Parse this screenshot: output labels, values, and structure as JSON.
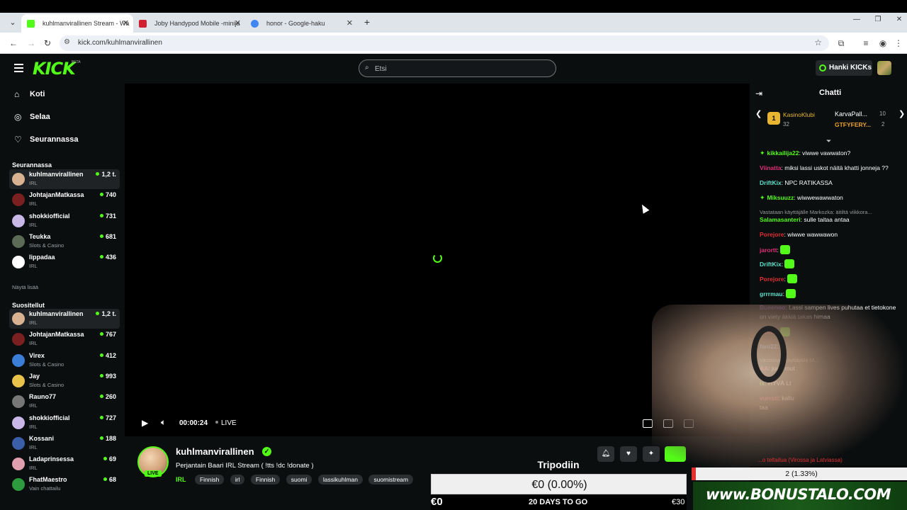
{
  "browser": {
    "tabs": [
      {
        "title": "kuhlmanvirallinen Stream - Wa",
        "favicon_color": "#53fc18"
      },
      {
        "title": "Joby Handypod Mobile -minija",
        "favicon_color": "#d01f2e"
      },
      {
        "title": "honor - Google-haku",
        "favicon_color": "#4285f4"
      }
    ],
    "url": "kick.com/kuhlmanvirallinen"
  },
  "header": {
    "logo": "KICK",
    "beta": "BETA",
    "search_placeholder": "Etsi",
    "get_kicks": "Hanki KICKs"
  },
  "sidebar": {
    "nav": [
      {
        "label": "Koti",
        "icon": "home-icon"
      },
      {
        "label": "Selaa",
        "icon": "browse-icon"
      },
      {
        "label": "Seurannassa",
        "icon": "heart-icon"
      }
    ],
    "following_title": "Seurannassa",
    "following": [
      {
        "name": "kuhlmanvirallinen",
        "category": "IRL",
        "viewers": "1,2 t.",
        "avatar": "#d9b391"
      },
      {
        "name": "JohtajanMatkassa",
        "category": "IRL",
        "viewers": "740",
        "avatar": "#7a2020"
      },
      {
        "name": "shokkiofficial",
        "category": "IRL",
        "viewers": "731",
        "avatar": "#c9b7e8"
      },
      {
        "name": "Teukka",
        "category": "Slots & Casino",
        "viewers": "681",
        "avatar": "#5b6b55"
      },
      {
        "name": "lippadaa",
        "category": "IRL",
        "viewers": "436",
        "avatar": "#ffffff"
      }
    ],
    "show_more": "Näytä lisää",
    "recommended_title": "Suositellut",
    "recommended": [
      {
        "name": "kuhlmanvirallinen",
        "category": "IRL",
        "viewers": "1,2 t.",
        "avatar": "#d9b391"
      },
      {
        "name": "JohtajanMatkassa",
        "category": "IRL",
        "viewers": "767",
        "avatar": "#7a2020"
      },
      {
        "name": "Virex",
        "category": "Slots & Casino",
        "viewers": "412",
        "avatar": "#3a7ed8"
      },
      {
        "name": "Jay",
        "category": "Slots & Casino",
        "viewers": "993",
        "avatar": "#e8c24a"
      },
      {
        "name": "Rauno77",
        "category": "IRL",
        "viewers": "260",
        "avatar": "#777777"
      },
      {
        "name": "shokkiofficial",
        "category": "IRL",
        "viewers": "727",
        "avatar": "#c9b7e8"
      },
      {
        "name": "Kossani",
        "category": "IRL",
        "viewers": "188",
        "avatar": "#3a5ea8"
      },
      {
        "name": "Ladaprinsessa",
        "category": "IRL",
        "viewers": "69",
        "avatar": "#e0a0b0"
      },
      {
        "name": "FhatMaestro",
        "category": "Vain chattailu",
        "viewers": "68",
        "avatar": "#2e9a3e"
      }
    ]
  },
  "player": {
    "time": "00:00:24",
    "live": "LIVE"
  },
  "channel": {
    "name": "kuhlmanvirallinen",
    "live_badge": "LIVE",
    "title": "Perjantain Baari IRL Stream ( !tts !dc !donate )",
    "category": "IRL",
    "tags": [
      "Finnish",
      "irl",
      "Finnish",
      "suomi",
      "lassikuhlman",
      "suomistream"
    ]
  },
  "chat": {
    "title": "Chatti",
    "leaderboard": {
      "first": {
        "name": "KasinoKlubi",
        "value": "32",
        "rank": "1"
      },
      "second": {
        "name": "KarvaPall...",
        "value": "10"
      },
      "third": {
        "name": "GTFYFERY...",
        "value": "2"
      }
    },
    "messages": [
      {
        "user": "kikkailija22",
        "color": "#53fc18",
        "text": ": viwwe vawwaton?",
        "badge": true
      },
      {
        "user": "Viinatta",
        "color": "#e0307a",
        "text": ": miksi lassi uskot näitä khatti jonneja ??"
      },
      {
        "user": "DriftKix",
        "color": "#5fe0c8",
        "text": ": NPC RATIKASSA"
      },
      {
        "user": "Miksuuzz",
        "color": "#53fc18",
        "text": ": wiwwewawwaton",
        "badge": true
      },
      {
        "reply": "Vastataan käyttäjälle Markozka: äitiltä viikkora..."
      },
      {
        "user": "Salamasanteri",
        "color": "#53fc18",
        "text": ": sulle taitaa antaa"
      },
      {
        "user": "Porejore",
        "color": "#e03030",
        "text": ": wiwwe wawwawon"
      },
      {
        "user": "jarortt",
        "color": "#e0307a",
        "text": ":",
        "emote": true
      },
      {
        "user": "DriftKix",
        "color": "#5fe0c8",
        "text": ":",
        "emote": true
      },
      {
        "user": "Porejore",
        "color": "#e03030",
        "text": ":",
        "emote": true
      },
      {
        "user": "grrrmau",
        "color": "#5fe0c8",
        "text": ":",
        "emote": true
      },
      {
        "user": "Bueenoo",
        "color": "#b080f0",
        "text": ": Lassi sampen lives puhutaa et tietokone on viety äkkiä takas himaa"
      },
      {
        "user": "jarortt",
        "color": "#e0307a",
        "text": ":",
        "emote": true
      },
      {
        "user": "fani22",
        "color": "#5fa0ff",
        "text": ": F"
      },
      {
        "reply": "Vastataan käyttäjälle M..."
      },
      {
        "user": "AA",
        "color": "#e0307a",
        "text": ": juu , mut"
      },
      {
        "user": "ix",
        "color": "#53fc18",
        "text": ": HYVÄ LI"
      },
      {
        "user": "vurrsti",
        "color": "#e0307a",
        "text": ": kallu"
      },
      {
        "user": "",
        "color": "#fff",
        "text": "taa"
      }
    ]
  },
  "overlay": {
    "goal_title": "Tripodiin",
    "goal_value": "€0 (0.00%)",
    "goal_start": "€0",
    "goal_days": "20 DAYS TO GO",
    "goal_end": "€30",
    "poll_question": "...o teltailua (Virossa ja Latviassa)",
    "poll_value": "2 (1.33%)",
    "sponsor": "www.BONUSTALO.COM"
  },
  "colors": {
    "accent": "#53fc18",
    "bg": "#0b0e0f"
  }
}
